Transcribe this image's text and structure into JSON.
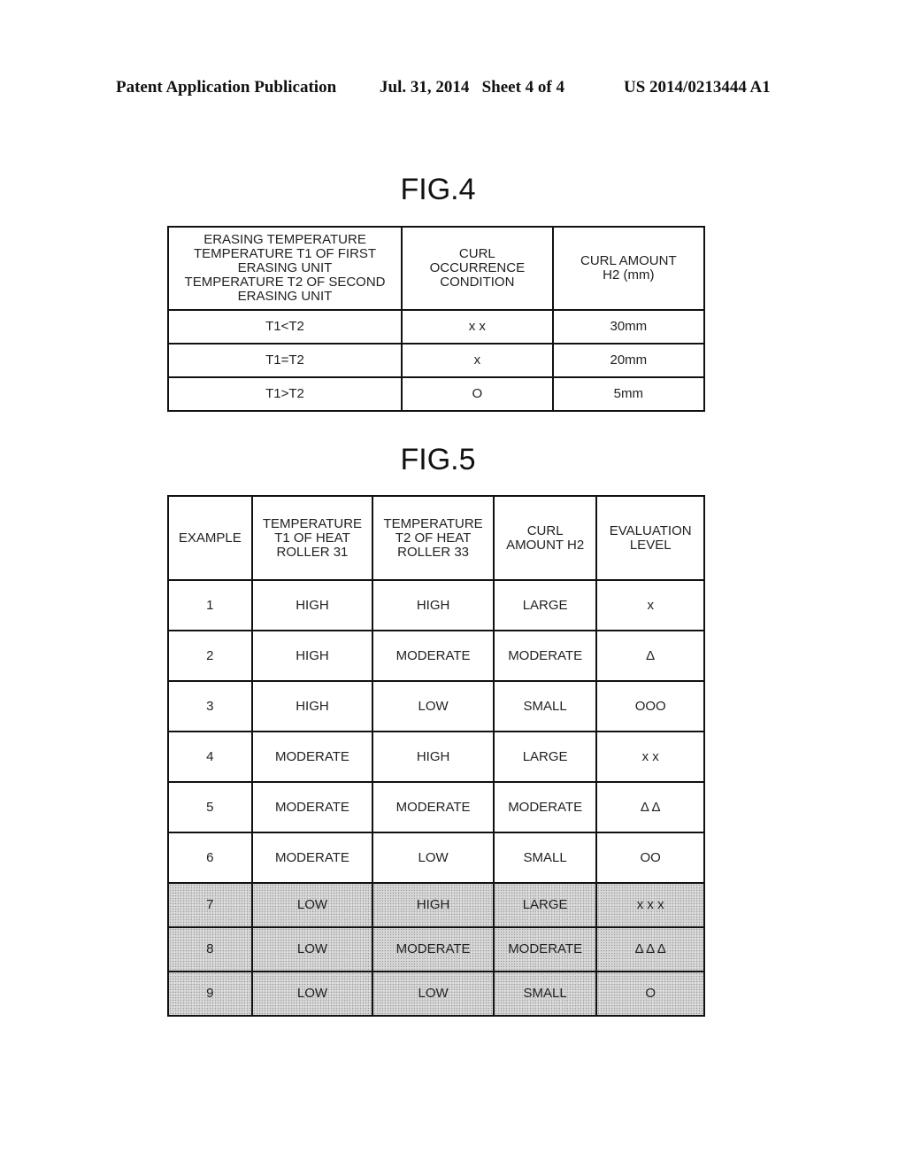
{
  "header": {
    "publication": "Patent Application Publication",
    "date_sheet": "Jul. 31, 2014   Sheet 4 of 4",
    "patent_number": "US 2014/0213444 A1"
  },
  "fig4": {
    "title": "FIG.4",
    "columns": [
      [
        "ERASING TEMPERATURE",
        "TEMPERATURE T1 OF FIRST",
        "ERASING UNIT",
        "TEMPERATURE T2 OF SECOND",
        "ERASING UNIT"
      ],
      [
        "CURL",
        "OCCURRENCE",
        "CONDITION"
      ],
      [
        "CURL AMOUNT",
        "H2 (mm)"
      ]
    ],
    "rows": [
      [
        "T1<T2",
        "x x",
        "30mm"
      ],
      [
        "T1=T2",
        "x",
        "20mm"
      ],
      [
        "T1>T2",
        "O",
        "5mm"
      ]
    ]
  },
  "fig5": {
    "title": "FIG.5",
    "columns": [
      [
        "EXAMPLE"
      ],
      [
        "TEMPERATURE",
        "T1 OF HEAT",
        "ROLLER 31"
      ],
      [
        "TEMPERATURE",
        "T2 OF HEAT",
        "ROLLER 33"
      ],
      [
        "CURL",
        "AMOUNT H2"
      ],
      [
        "EVALUATION",
        "LEVEL"
      ]
    ],
    "rows": [
      {
        "cells": [
          "1",
          "HIGH",
          "HIGH",
          "LARGE",
          "x"
        ],
        "shaded": false
      },
      {
        "cells": [
          "2",
          "HIGH",
          "MODERATE",
          "MODERATE",
          "Δ"
        ],
        "shaded": false
      },
      {
        "cells": [
          "3",
          "HIGH",
          "LOW",
          "SMALL",
          "OOO"
        ],
        "shaded": false
      },
      {
        "cells": [
          "4",
          "MODERATE",
          "HIGH",
          "LARGE",
          "x x"
        ],
        "shaded": false
      },
      {
        "cells": [
          "5",
          "MODERATE",
          "MODERATE",
          "MODERATE",
          "Δ Δ"
        ],
        "shaded": false
      },
      {
        "cells": [
          "6",
          "MODERATE",
          "LOW",
          "SMALL",
          "OO"
        ],
        "shaded": false
      },
      {
        "cells": [
          "7",
          "LOW",
          "HIGH",
          "LARGE",
          "x x x"
        ],
        "shaded": true
      },
      {
        "cells": [
          "8",
          "LOW",
          "MODERATE",
          "MODERATE",
          "Δ Δ Δ"
        ],
        "shaded": true
      },
      {
        "cells": [
          "9",
          "LOW",
          "LOW",
          "SMALL",
          "O"
        ],
        "shaded": true
      }
    ]
  }
}
